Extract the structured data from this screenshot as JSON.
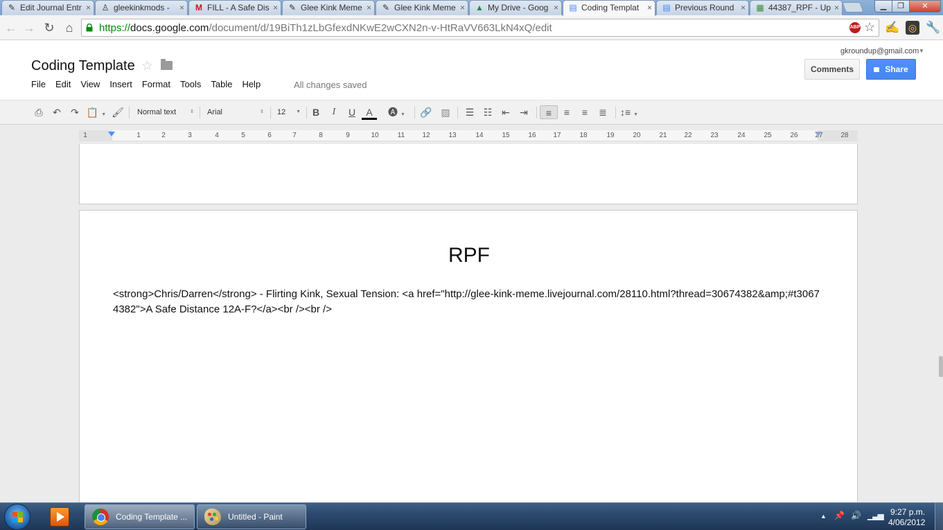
{
  "browser": {
    "tabs": [
      {
        "label": "Edit Journal Entr",
        "icon": "pencil"
      },
      {
        "label": "gleekinkmods - ",
        "icon": "livejournal-user"
      },
      {
        "label": "FILL - A Safe Dis",
        "icon": "gmail"
      },
      {
        "label": "Glee Kink Meme ",
        "icon": "pencil"
      },
      {
        "label": "Glee Kink Meme ",
        "icon": "pencil"
      },
      {
        "label": "My Drive - Goog",
        "icon": "drive"
      },
      {
        "label": "Coding Templat",
        "icon": "docs",
        "active": true
      },
      {
        "label": "Previous Round",
        "icon": "docs"
      },
      {
        "label": "44387_RPF - Upl",
        "icon": "image"
      }
    ],
    "tab_close_glyph": "×",
    "url": {
      "scheme": "https://",
      "host": "docs.google.com",
      "path": "/document/d/19BiTh1zLbGfexdNKwE2wCXN2n-v-HtRaVV663LkN4xQ/edit"
    },
    "abp_label": "ABP"
  },
  "docs": {
    "account": "gkroundup@gmail.com",
    "title": "Coding Template",
    "comments_label": "Comments",
    "share_label": "Share",
    "menus": [
      "File",
      "Edit",
      "View",
      "Insert",
      "Format",
      "Tools",
      "Table",
      "Help"
    ],
    "save_status": "All changes saved",
    "toolbar": {
      "style": "Normal text",
      "font": "Arial",
      "size": "12",
      "bold": "B",
      "italic": "I",
      "underline": "U",
      "text_color": "A"
    },
    "ruler_numbers": [
      "1",
      "1",
      "2",
      "3",
      "4",
      "5",
      "6",
      "7",
      "8",
      "9",
      "10",
      "11",
      "12",
      "13",
      "14",
      "15",
      "16",
      "17",
      "18",
      "19",
      "20",
      "21",
      "22",
      "23",
      "24",
      "25",
      "26",
      "27",
      "28"
    ],
    "page": {
      "heading": "RPF",
      "body": "<strong>Chris/Darren</strong> - Flirting Kink, Sexual Tension: <a href=\"http://glee-kink-meme.livejournal.com/28110.html?thread=30674382&amp;#t30674382\">A Safe Distance 12A-F?</a><br /><br />"
    }
  },
  "taskbar": {
    "items": [
      {
        "label": "Coding Template ...",
        "app": "chrome"
      },
      {
        "label": "Untitled - Paint",
        "app": "paint"
      }
    ],
    "time": "9:27 p.m.",
    "date": "4/06/2012"
  }
}
